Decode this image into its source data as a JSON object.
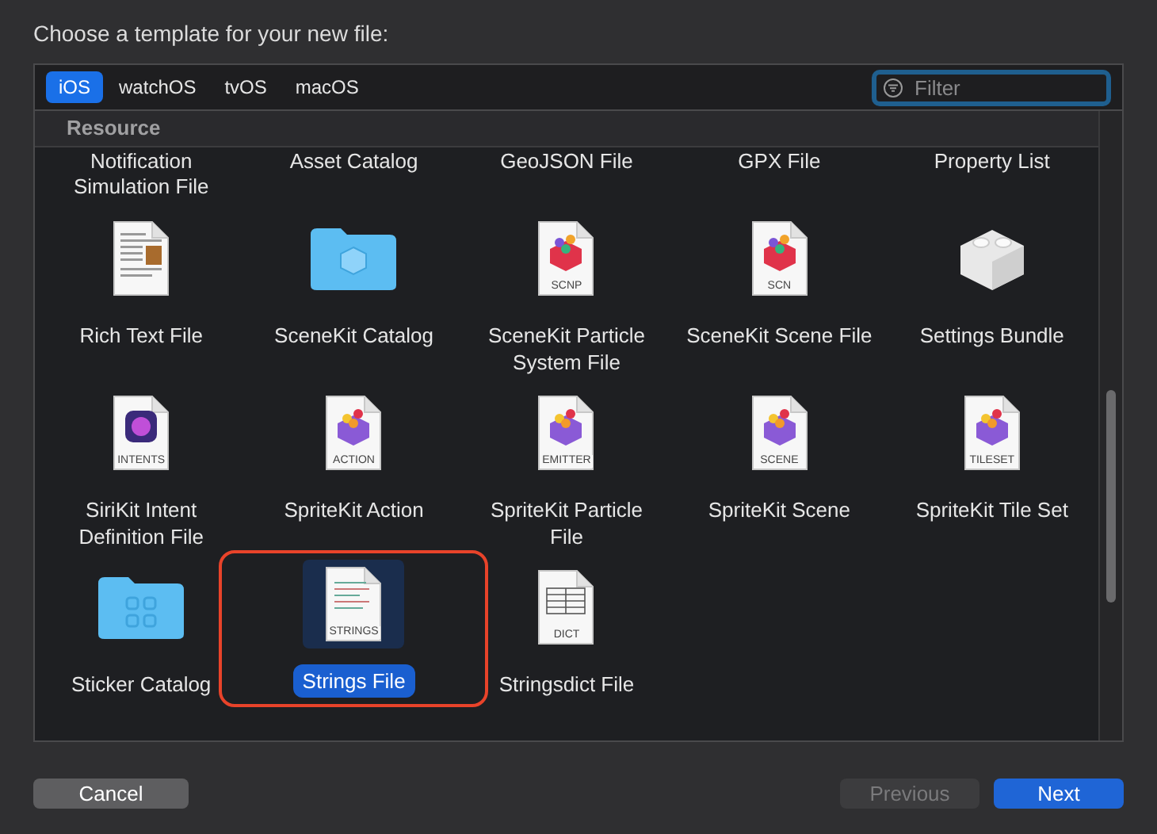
{
  "prompt": "Choose a template for your new file:",
  "tabs": [
    {
      "label": "iOS",
      "selected": true
    },
    {
      "label": "watchOS",
      "selected": false
    },
    {
      "label": "tvOS",
      "selected": false
    },
    {
      "label": "macOS",
      "selected": false
    }
  ],
  "filter": {
    "placeholder": "Filter",
    "focused": true
  },
  "section": {
    "title": "Resource"
  },
  "partial_row": [
    "Notification Simulation File",
    "Asset Catalog",
    "GeoJSON File",
    "GPX File",
    "Property List"
  ],
  "templates": [
    {
      "name": "Rich Text File",
      "kind": "richtext",
      "selected": false,
      "highlighted": false
    },
    {
      "name": "SceneKit Catalog",
      "kind": "folder",
      "selected": false,
      "highlighted": false
    },
    {
      "name": "SceneKit Particle System File",
      "kind": "scenekit",
      "tag": "SCNP",
      "selected": false,
      "highlighted": false
    },
    {
      "name": "SceneKit Scene File",
      "kind": "scenekit",
      "tag": "SCN",
      "selected": false,
      "highlighted": false
    },
    {
      "name": "Settings Bundle",
      "kind": "brick",
      "selected": false,
      "highlighted": false
    },
    {
      "name": "SiriKit Intent Definition File",
      "kind": "siri",
      "tag": "INTENTS",
      "selected": false,
      "highlighted": false
    },
    {
      "name": "SpriteKit Action",
      "kind": "spritekit",
      "tag": "ACTION",
      "selected": false,
      "highlighted": false
    },
    {
      "name": "SpriteKit Particle File",
      "kind": "spritekit",
      "tag": "EMITTER",
      "selected": false,
      "highlighted": false
    },
    {
      "name": "SpriteKit Scene",
      "kind": "spritekit",
      "tag": "SCENE",
      "selected": false,
      "highlighted": false
    },
    {
      "name": "SpriteKit Tile Set",
      "kind": "spritekit",
      "tag": "TILESET",
      "selected": false,
      "highlighted": false
    },
    {
      "name": "Sticker Catalog",
      "kind": "sticker",
      "selected": false,
      "highlighted": false
    },
    {
      "name": "Strings File",
      "kind": "text",
      "tag": "STRINGS",
      "selected": true,
      "highlighted": true
    },
    {
      "name": "Stringsdict File",
      "kind": "table",
      "tag": "DICT",
      "selected": false,
      "highlighted": false
    }
  ],
  "buttons": [
    {
      "label": "Cancel",
      "kind": "normal",
      "disabled": false
    },
    {
      "label": "Previous",
      "kind": "normal",
      "disabled": true
    },
    {
      "label": "Next",
      "kind": "primary",
      "disabled": false
    }
  ]
}
